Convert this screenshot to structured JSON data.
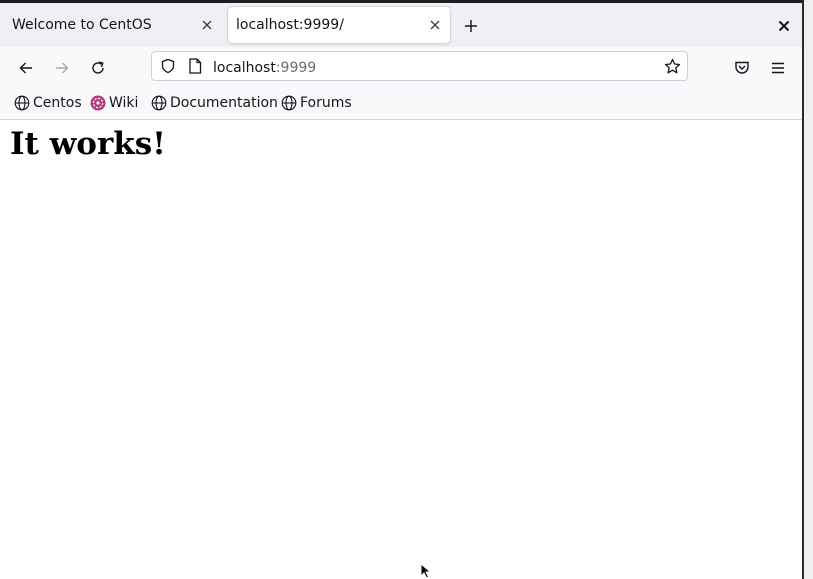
{
  "tabs": [
    {
      "title": "Welcome to CentOS",
      "active": false
    },
    {
      "title": "localhost:9999/",
      "active": true
    }
  ],
  "urlbar": {
    "host": "localhost",
    "port": ":9999"
  },
  "bookmarks": [
    {
      "label": "Centos",
      "icon": "globe-icon"
    },
    {
      "label": "Wiki",
      "icon": "wiki-flower-icon"
    },
    {
      "label": "Documentation",
      "icon": "globe-icon"
    },
    {
      "label": "Forums",
      "icon": "globe-icon"
    }
  ],
  "page": {
    "heading": "It works!"
  },
  "colors": {
    "wiki_icon": "#b3387c",
    "tab_active_bg": "#ffffff",
    "toolbar_bg": "#f9f9fb"
  }
}
